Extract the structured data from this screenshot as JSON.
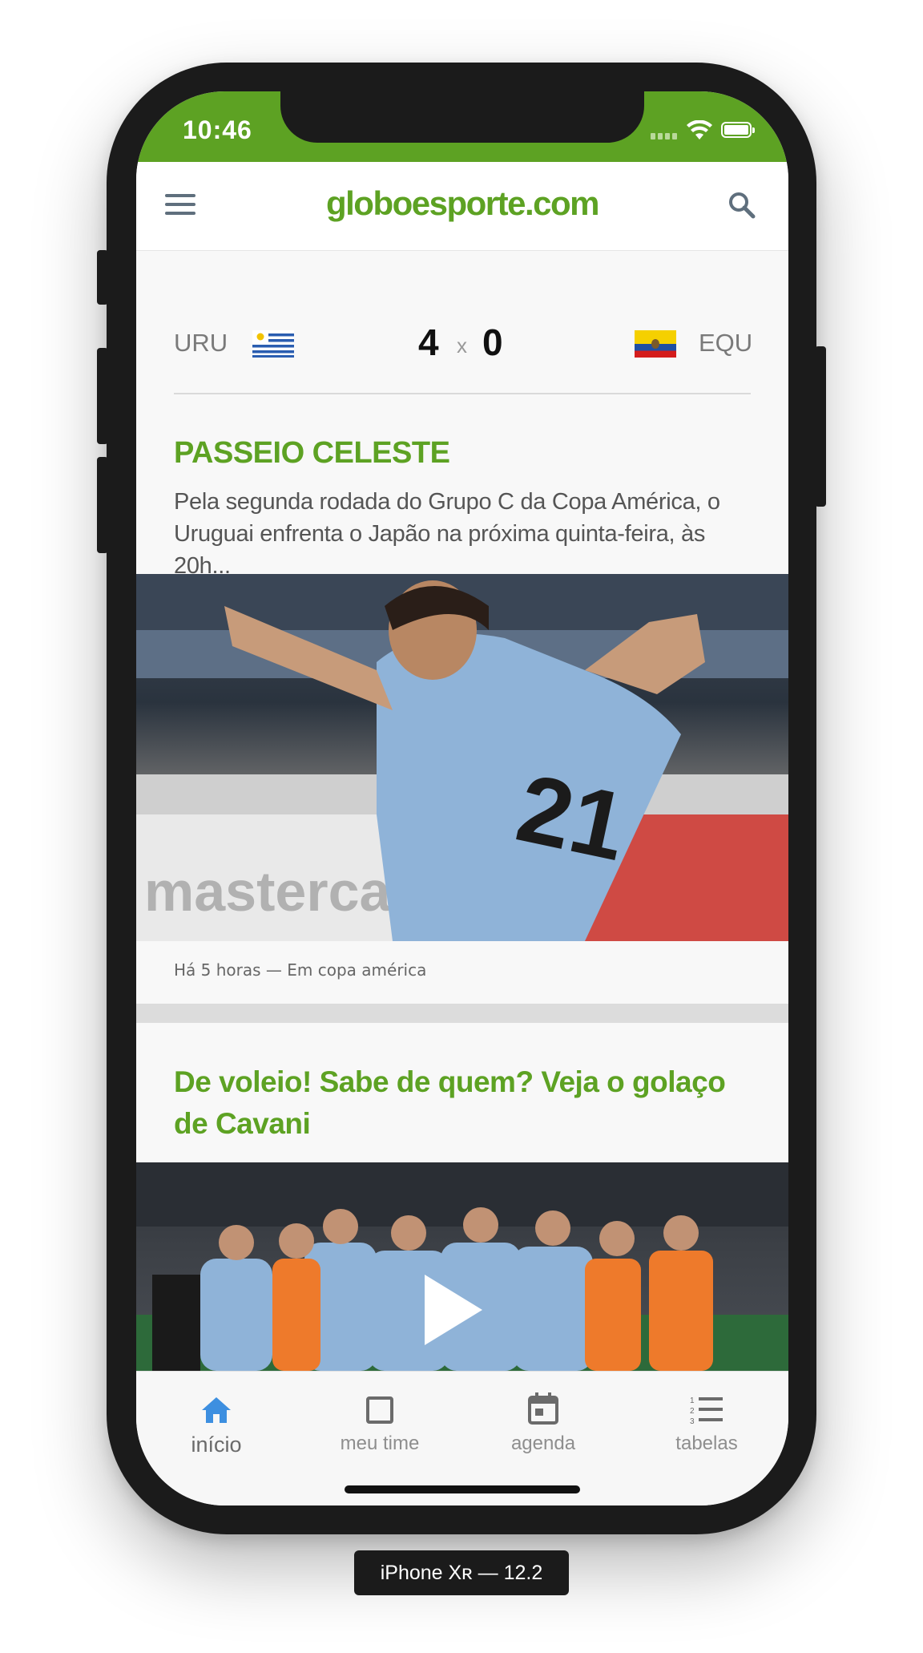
{
  "status_bar": {
    "time": "10:46"
  },
  "header": {
    "logo": "globoesporte.com"
  },
  "match": {
    "home_team": "URU",
    "home_score": "4",
    "separator": "x",
    "away_score": "0",
    "away_team": "EQU"
  },
  "article1": {
    "headline": "PASSEIO CELESTE",
    "summary": "Pela segunda rodada do Grupo C da Copa América, o Uruguai enfrenta o Japão na próxima quinta-feira, às 20h...",
    "meta": "Há 5 horas — Em copa américa"
  },
  "article2": {
    "headline": "De voleio! Sabe de quem? Veja o golaço de Cavani"
  },
  "tabs": [
    {
      "label": "início",
      "icon": "home-icon",
      "active": true
    },
    {
      "label": "meu time",
      "icon": "square-icon",
      "active": false
    },
    {
      "label": "agenda",
      "icon": "calendar-icon",
      "active": false
    },
    {
      "label": "tabelas",
      "icon": "list-icon",
      "active": false
    }
  ],
  "device_label": "iPhone Xʀ — 12.2",
  "colors": {
    "brand": "#5da223",
    "active_tab": "#3d8fe0"
  }
}
